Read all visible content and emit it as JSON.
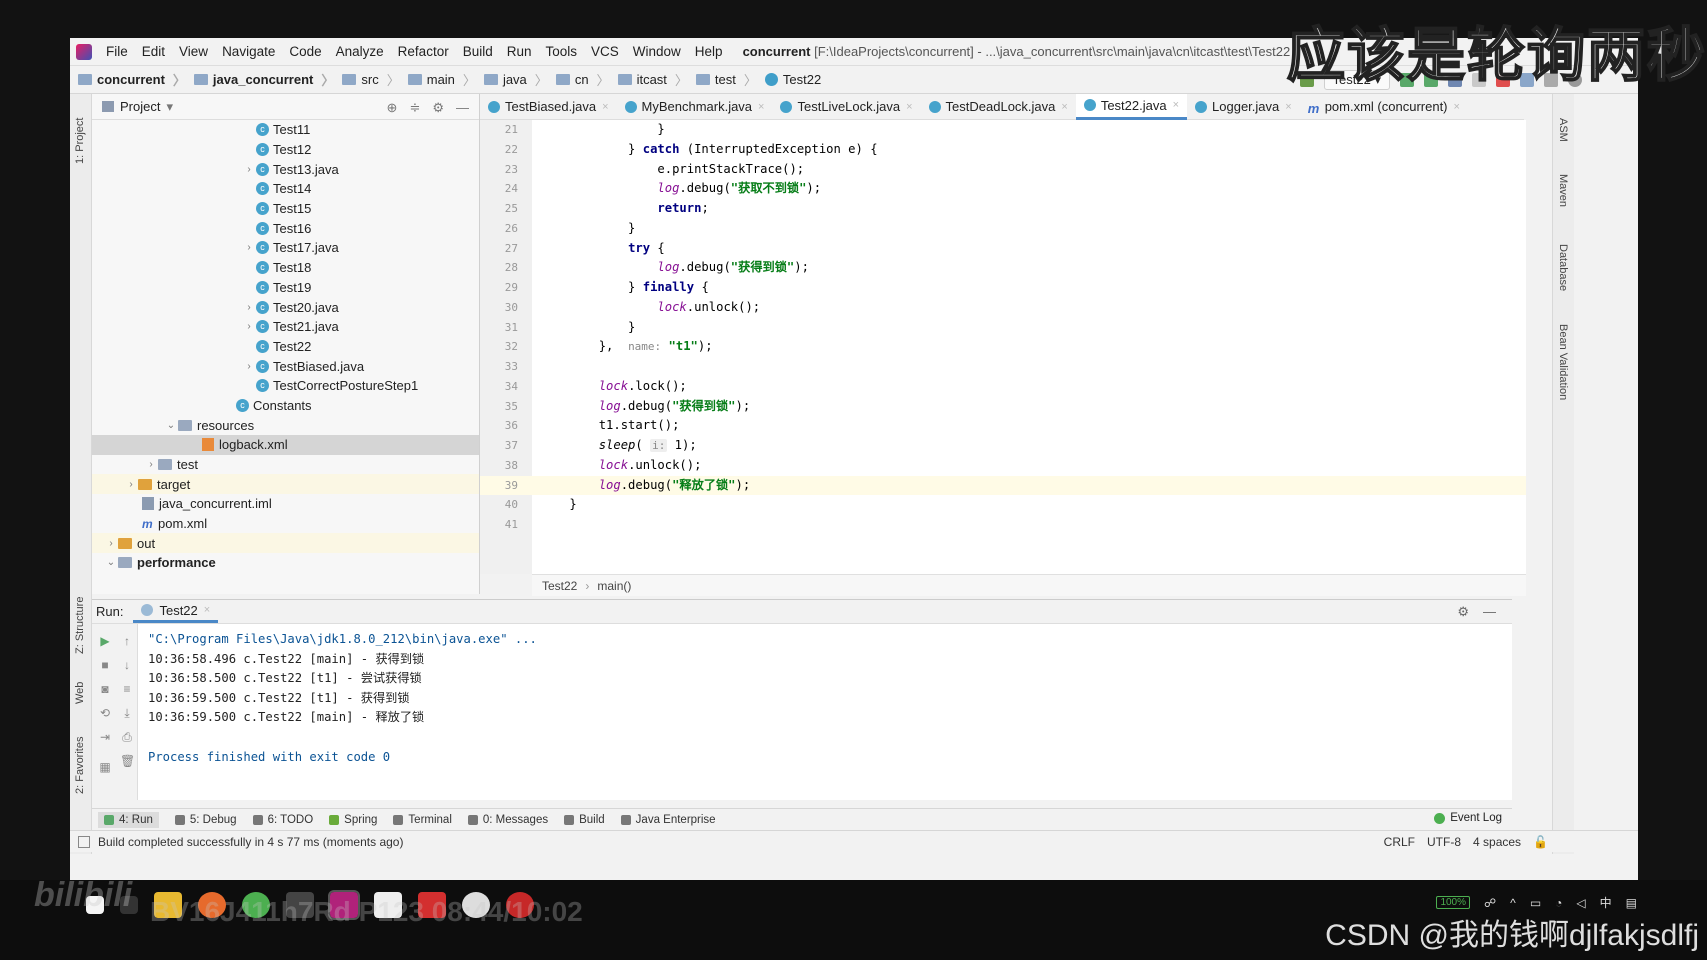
{
  "menubar": {
    "items": [
      "File",
      "Edit",
      "View",
      "Navigate",
      "Code",
      "Analyze",
      "Refactor",
      "Build",
      "Run",
      "Tools",
      "VCS",
      "Window",
      "Help"
    ],
    "title_project": "concurrent",
    "title_path": "[F:\\IdeaProjects\\concurrent] - ...\\java_concurrent\\src\\main\\java\\cn\\itcast\\test\\Test22"
  },
  "breadcrumb": [
    "concurrent",
    "java_concurrent",
    "src",
    "main",
    "java",
    "cn",
    "itcast",
    "test",
    "Test22"
  ],
  "toolbar": {
    "run_config": "Test22"
  },
  "left_strip": {
    "project": "1: Project",
    "structure": "Z: Structure",
    "web": "Web",
    "favorites": "2: Favorites"
  },
  "right_strip": {
    "asm": "ASM",
    "maven": "Maven",
    "database": "Database",
    "bean": "Bean Validation"
  },
  "project_panel": {
    "title": "Project",
    "tree": [
      {
        "label": "Test11",
        "indent": 170,
        "type": "class",
        "arrow": false
      },
      {
        "label": "Test12",
        "indent": 170,
        "type": "class",
        "arrow": false
      },
      {
        "label": "Test13.java",
        "indent": 170,
        "type": "class",
        "arrow": true
      },
      {
        "label": "Test14",
        "indent": 170,
        "type": "class",
        "arrow": false
      },
      {
        "label": "Test15",
        "indent": 170,
        "type": "class",
        "arrow": false
      },
      {
        "label": "Test16",
        "indent": 170,
        "type": "class",
        "arrow": false
      },
      {
        "label": "Test17.java",
        "indent": 170,
        "type": "class",
        "arrow": true
      },
      {
        "label": "Test18",
        "indent": 170,
        "type": "class",
        "arrow": false
      },
      {
        "label": "Test19",
        "indent": 170,
        "type": "class",
        "arrow": false
      },
      {
        "label": "Test20.java",
        "indent": 170,
        "type": "class",
        "arrow": true
      },
      {
        "label": "Test21.java",
        "indent": 170,
        "type": "class",
        "arrow": true
      },
      {
        "label": "Test22",
        "indent": 170,
        "type": "class",
        "arrow": false
      },
      {
        "label": "TestBiased.java",
        "indent": 170,
        "type": "class",
        "arrow": true
      },
      {
        "label": "TestCorrectPostureStep1",
        "indent": 170,
        "type": "class",
        "arrow": false
      },
      {
        "label": "Constants",
        "indent": 150,
        "type": "class",
        "arrow": false
      },
      {
        "label": "resources",
        "indent": 92,
        "type": "folder",
        "arrow": true
      },
      {
        "label": "logback.xml",
        "indent": 116,
        "type": "xml",
        "arrow": false,
        "selected": true
      },
      {
        "label": "test",
        "indent": 72,
        "type": "folder",
        "arrow": true
      },
      {
        "label": "target",
        "indent": 52,
        "type": "folder-orange",
        "arrow": true,
        "hl": true
      },
      {
        "label": "java_concurrent.iml",
        "indent": 56,
        "type": "iml",
        "arrow": false
      },
      {
        "label": "pom.xml",
        "indent": 56,
        "type": "maven",
        "arrow": false
      },
      {
        "label": "out",
        "indent": 32,
        "type": "folder-orange",
        "arrow": true,
        "hl": true
      },
      {
        "label": "performance",
        "indent": 32,
        "type": "folder",
        "arrow": true,
        "bold": true
      }
    ]
  },
  "editor": {
    "tabs": [
      {
        "label": "TestBiased.java",
        "active": false
      },
      {
        "label": "MyBenchmark.java",
        "active": false
      },
      {
        "label": "TestLiveLock.java",
        "active": false
      },
      {
        "label": "TestDeadLock.java",
        "active": false
      },
      {
        "label": "Test22.java",
        "active": true
      },
      {
        "label": "Logger.java",
        "active": false
      },
      {
        "label": "pom.xml (concurrent)",
        "active": false
      }
    ],
    "line_numbers": [
      "21",
      "22",
      "23",
      "24",
      "25",
      "26",
      "27",
      "28",
      "29",
      "30",
      "31",
      "32",
      "33",
      "34",
      "35",
      "36",
      "37",
      "38",
      "39",
      "40",
      "41"
    ],
    "current_line_index": 18,
    "lines": [
      "                }",
      "            } catch (InterruptedException e) {",
      "                e.printStackTrace();",
      "                log.debug(\"获取不到锁\");",
      "                return;",
      "            }",
      "            try {",
      "                log.debug(\"获得到锁\");",
      "            } finally {",
      "                lock.unlock();",
      "            }",
      "        },  name: \"t1\");",
      "",
      "        lock.lock();",
      "        log.debug(\"获得到锁\");",
      "        t1.start();",
      "        sleep( i: 1);",
      "        lock.unlock();",
      "        log.debug(\"释放了锁\");",
      "    }",
      ""
    ],
    "breadcrumb": [
      "Test22",
      "main()"
    ]
  },
  "run": {
    "label": "Run:",
    "tab": "Test22",
    "console": [
      "\"C:\\Program Files\\Java\\jdk1.8.0_212\\bin\\java.exe\" ...",
      "10:36:58.496 c.Test22 [main] - 获得到锁",
      "10:36:58.500 c.Test22 [t1] - 尝试获得锁",
      "10:36:59.500 c.Test22 [t1] - 获得到锁",
      "10:36:59.500 c.Test22 [main] - 释放了锁",
      "",
      "Process finished with exit code 0"
    ]
  },
  "tool_tabs": [
    "4: Run",
    "5: Debug",
    "6: TODO",
    "Spring",
    "Terminal",
    "0: Messages",
    "Build",
    "Java Enterprise"
  ],
  "event_log": "Event Log",
  "status": {
    "message": "Build completed successfully in 4 s 77 ms (moments ago)",
    "line_sep": "CRLF",
    "encoding": "UTF-8",
    "indent": "4 spaces"
  },
  "taskbar": {
    "battery": "100%",
    "ime": "中"
  },
  "overlays": {
    "subtitle": "应该是轮询两秒",
    "bili_logo": "bilibili",
    "bv": "BV16J411h7Rd P123 08:44/10:02",
    "csdn": "CSDN @我的钱啊djlfakjsdlfj"
  },
  "colors": {
    "accent": "#4a88c7",
    "keyword": "#000080",
    "string": "#067d17",
    "field": "#871094"
  }
}
